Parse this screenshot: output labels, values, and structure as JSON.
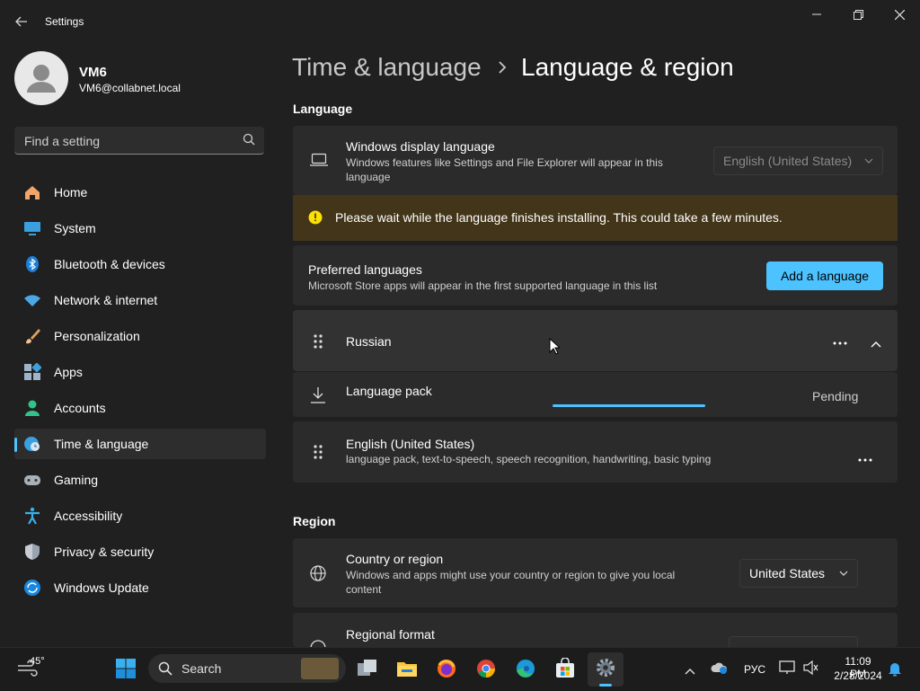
{
  "window": {
    "title": "Settings"
  },
  "profile": {
    "name": "VM6",
    "email": "VM6@collabnet.local"
  },
  "search": {
    "placeholder": "Find a setting"
  },
  "nav": {
    "items": [
      {
        "label": "Home"
      },
      {
        "label": "System"
      },
      {
        "label": "Bluetooth & devices"
      },
      {
        "label": "Network & internet"
      },
      {
        "label": "Personalization"
      },
      {
        "label": "Apps"
      },
      {
        "label": "Accounts"
      },
      {
        "label": "Time & language"
      },
      {
        "label": "Gaming"
      },
      {
        "label": "Accessibility"
      },
      {
        "label": "Privacy & security"
      },
      {
        "label": "Windows Update"
      }
    ],
    "selected": "Time & language"
  },
  "header": {
    "parent": "Time & language",
    "current": "Language & region"
  },
  "language": {
    "section_title": "Language",
    "display": {
      "title": "Windows display language",
      "subtitle": "Windows features like Settings and File Explorer will appear in this language",
      "value": "English (United States)"
    },
    "warning": "Please wait while the language finishes installing. This could take a few minutes.",
    "preferred": {
      "title": "Preferred languages",
      "subtitle": "Microsoft Store apps will appear in the first supported language in this list",
      "add_button": "Add a language"
    },
    "russian": {
      "name": "Russian",
      "pack_label": "Language pack",
      "status": "Pending"
    },
    "english": {
      "name": "English (United States)",
      "subtitle": "language pack, text-to-speech, speech recognition, handwriting, basic typing"
    }
  },
  "region": {
    "section_title": "Region",
    "country": {
      "title": "Country or region",
      "subtitle": "Windows and apps might use your country or region to give you local content",
      "value": "United States"
    },
    "format": {
      "title": "Regional format"
    }
  },
  "taskbar": {
    "weather_temp": "45°",
    "search_label": "Search",
    "input_lang": "РУС",
    "time": "11:09 PM",
    "date": "2/28/2024"
  },
  "colors": {
    "accent": "#4cc2ff",
    "background": "#202020",
    "card": "#2b2b2b",
    "warning_bg": "#433519",
    "warning_icon": "#fce100"
  }
}
